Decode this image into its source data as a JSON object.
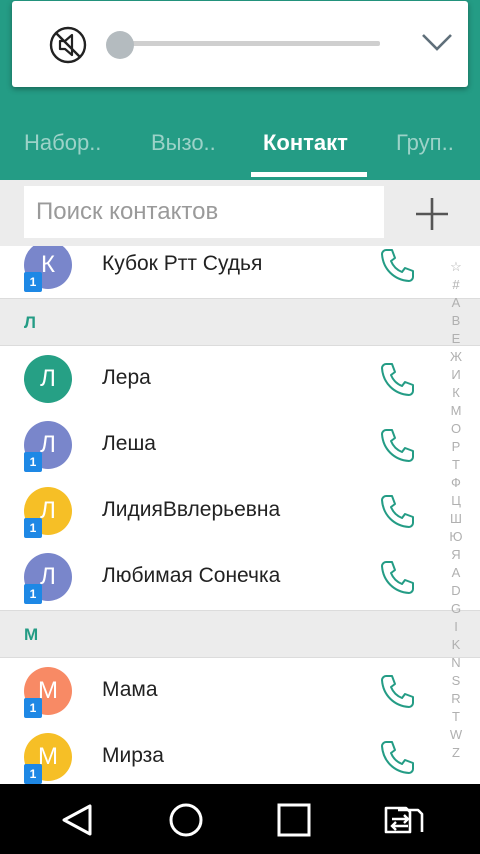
{
  "colors": {
    "accent": "#249c85",
    "section_bg": "#ececec",
    "sim_badge": "#1e88e5"
  },
  "volume_panel": {
    "icons": [
      "volume-mute-icon",
      "chevron-down-icon"
    ],
    "level": 0
  },
  "tabs": [
    {
      "label": "Набор..",
      "active": false
    },
    {
      "label": "Вызо..",
      "active": false
    },
    {
      "label": "Контакт",
      "active": true
    },
    {
      "label": "Груп..",
      "active": false
    }
  ],
  "search": {
    "placeholder": "Поиск контактов",
    "add_icon": "plus-icon"
  },
  "contacts": [
    {
      "type": "contact",
      "initial": "К",
      "color": "#7986cb",
      "sim": "1",
      "name": "Кубок Ртт Судья"
    },
    {
      "type": "header",
      "letter": "Л"
    },
    {
      "type": "contact",
      "initial": "Л",
      "color": "#26a085",
      "sim": "",
      "name": "Лера"
    },
    {
      "type": "contact",
      "initial": "Л",
      "color": "#7986cb",
      "sim": "1",
      "name": "Леша"
    },
    {
      "type": "contact",
      "initial": "Л",
      "color": "#f6bf26",
      "sim": "1",
      "name": "ЛидияВвлерьевна"
    },
    {
      "type": "contact",
      "initial": "Л",
      "color": "#7986cb",
      "sim": "1",
      "name": "Любимая Сонечка"
    },
    {
      "type": "header",
      "letter": "М"
    },
    {
      "type": "contact",
      "initial": "М",
      "color": "#f88a65",
      "sim": "1",
      "name": "Мама"
    },
    {
      "type": "contact",
      "initial": "М",
      "color": "#f6bf26",
      "sim": "1",
      "name": "Мирза"
    }
  ],
  "index_letters": [
    "☆",
    "#",
    "А",
    "В",
    "Е",
    "Ж",
    "И",
    "К",
    "М",
    "О",
    "Р",
    "Т",
    "Ф",
    "Ц",
    "Ш",
    "Ю",
    "Я",
    "A",
    "D",
    "G",
    "I",
    "K",
    "N",
    "S",
    "R",
    "T",
    "W",
    "Z"
  ],
  "navbar": [
    "back-icon",
    "home-icon",
    "recents-icon",
    "sim-switch-icon"
  ]
}
